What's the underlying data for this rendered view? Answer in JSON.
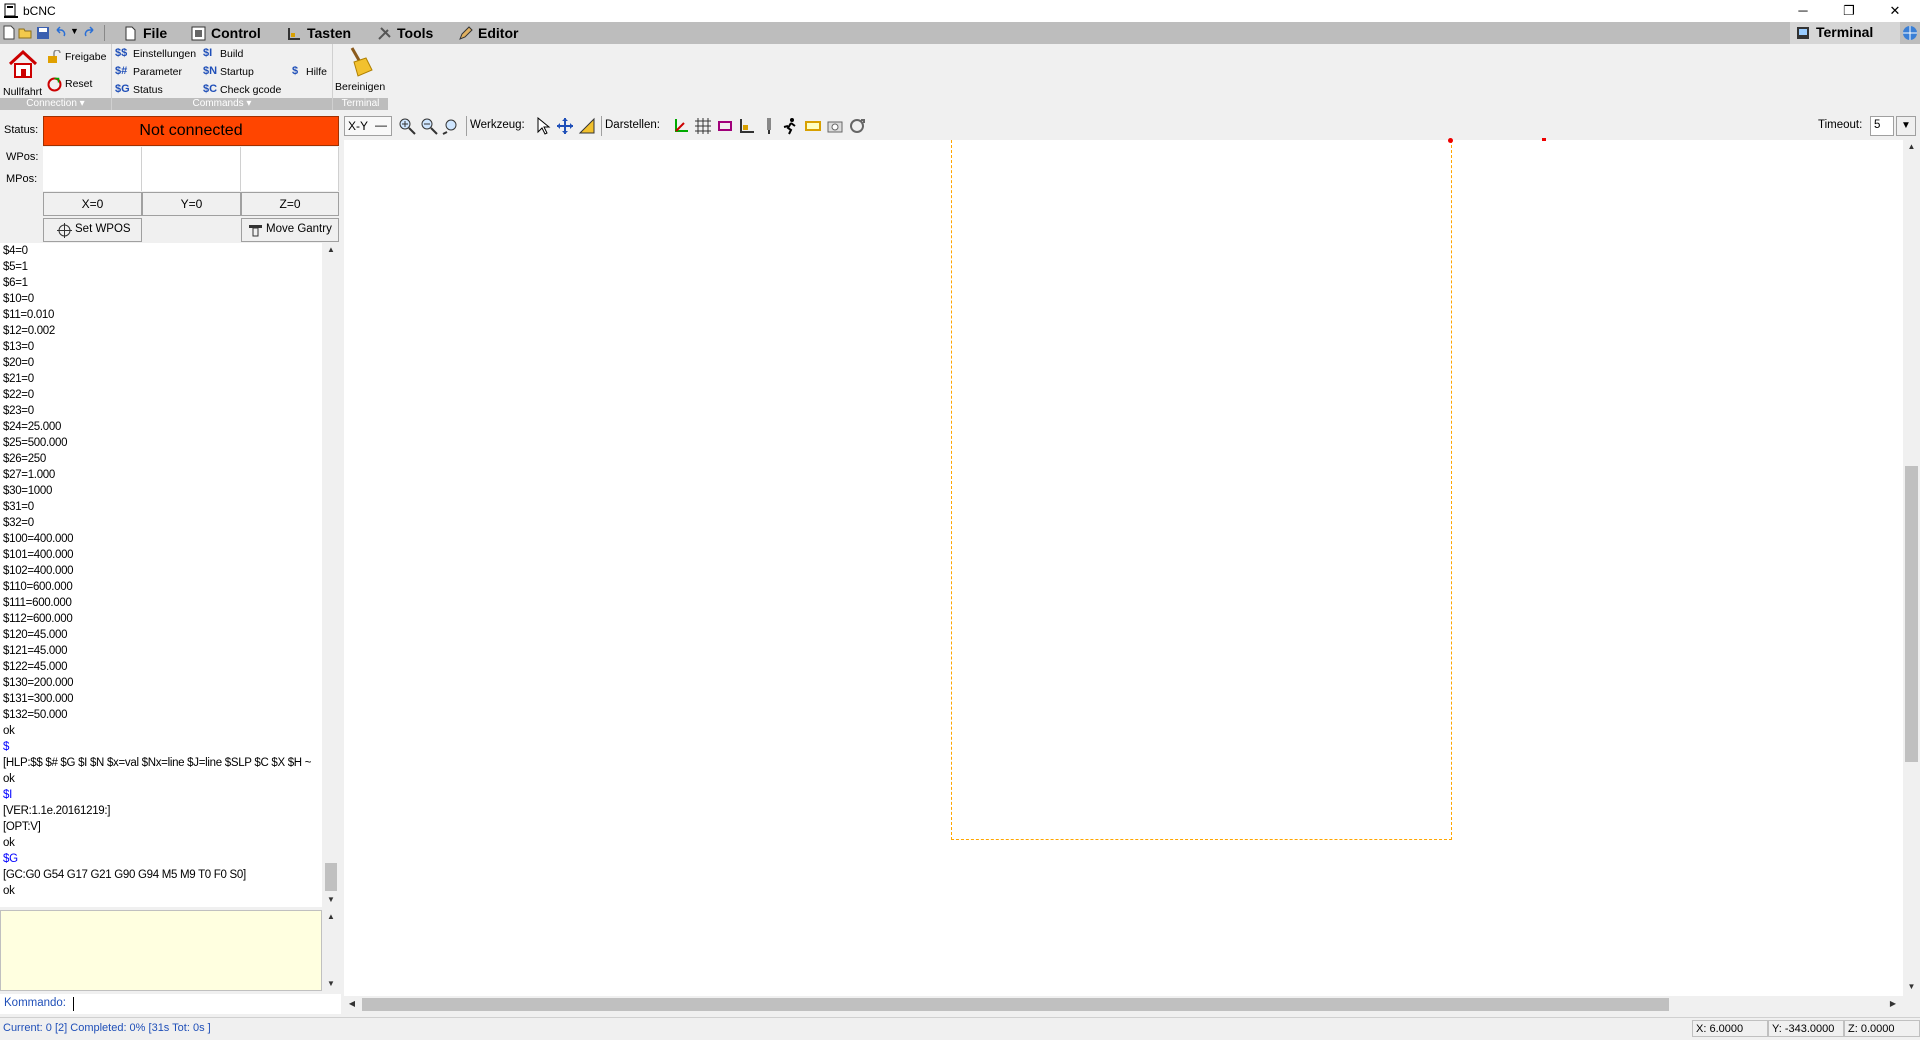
{
  "window": {
    "title": "bCNC",
    "minimize": "─",
    "restore": "❐",
    "close": "✕"
  },
  "menubar": {
    "items": [
      "File",
      "Control",
      "Tasten",
      "Tools",
      "Editor"
    ],
    "terminal_tab": "Terminal"
  },
  "ribbon": {
    "connection": {
      "home_label": "Nullfahrt",
      "unlock_label": "Freigabe",
      "reset_label": "Reset",
      "footer": "Connection"
    },
    "commands": {
      "items": [
        {
          "code": "$$",
          "label": "Einstellungen"
        },
        {
          "code": "$#",
          "label": "Parameter"
        },
        {
          "code": "$G",
          "label": "Status"
        },
        {
          "code": "$I",
          "label": "Build"
        },
        {
          "code": "$N",
          "label": "Startup"
        },
        {
          "code": "$C",
          "label": "Check gcode"
        },
        {
          "code": "$",
          "label": "Hilfe"
        }
      ],
      "footer": "Commands"
    },
    "terminal": {
      "clear_label": "Bereinigen",
      "footer": "Terminal"
    }
  },
  "dro": {
    "status_label": "Status:",
    "status_value": "Not connected",
    "wpos_label": "WPos:",
    "mpos_label": "MPos:",
    "zero_x": "X=0",
    "zero_y": "Y=0",
    "zero_z": "Z=0",
    "set_wpos": "Set WPOS",
    "move_gantry": "Move Gantry"
  },
  "terminal_lines": [
    {
      "text": "$4=0",
      "cmd": false
    },
    {
      "text": "$5=1",
      "cmd": false
    },
    {
      "text": "$6=1",
      "cmd": false
    },
    {
      "text": "$10=0",
      "cmd": false
    },
    {
      "text": "$11=0.010",
      "cmd": false
    },
    {
      "text": "$12=0.002",
      "cmd": false
    },
    {
      "text": "$13=0",
      "cmd": false
    },
    {
      "text": "$20=0",
      "cmd": false
    },
    {
      "text": "$21=0",
      "cmd": false
    },
    {
      "text": "$22=0",
      "cmd": false
    },
    {
      "text": "$23=0",
      "cmd": false
    },
    {
      "text": "$24=25.000",
      "cmd": false
    },
    {
      "text": "$25=500.000",
      "cmd": false
    },
    {
      "text": "$26=250",
      "cmd": false
    },
    {
      "text": "$27=1.000",
      "cmd": false
    },
    {
      "text": "$30=1000",
      "cmd": false
    },
    {
      "text": "$31=0",
      "cmd": false
    },
    {
      "text": "$32=0",
      "cmd": false
    },
    {
      "text": "$100=400.000",
      "cmd": false
    },
    {
      "text": "$101=400.000",
      "cmd": false
    },
    {
      "text": "$102=400.000",
      "cmd": false
    },
    {
      "text": "$110=600.000",
      "cmd": false
    },
    {
      "text": "$111=600.000",
      "cmd": false
    },
    {
      "text": "$112=600.000",
      "cmd": false
    },
    {
      "text": "$120=45.000",
      "cmd": false
    },
    {
      "text": "$121=45.000",
      "cmd": false
    },
    {
      "text": "$122=45.000",
      "cmd": false
    },
    {
      "text": "$130=200.000",
      "cmd": false
    },
    {
      "text": "$131=300.000",
      "cmd": false
    },
    {
      "text": "$132=50.000",
      "cmd": false
    },
    {
      "text": "ok",
      "cmd": false
    },
    {
      "text": "$",
      "cmd": true
    },
    {
      "text": "[HLP:$$ $# $G $I $N $x=val $Nx=line $J=line $SLP $C $X $H ~",
      "cmd": false
    },
    {
      "text": "ok",
      "cmd": false
    },
    {
      "text": "$I",
      "cmd": true
    },
    {
      "text": "[VER:1.1e.20161219:]",
      "cmd": false
    },
    {
      "text": "[OPT:V]",
      "cmd": false
    },
    {
      "text": "ok",
      "cmd": false
    },
    {
      "text": "$G",
      "cmd": true
    },
    {
      "text": "[GC:G0 G54 G17 G21 G90 G94 M5 M9 T0 F0 S0]",
      "cmd": false
    },
    {
      "text": "ok",
      "cmd": false
    }
  ],
  "kommando_label": "Kommando:",
  "canvas_toolbar": {
    "view": "X-Y",
    "werkzeug_label": "Werkzeug:",
    "darstellen_label": "Darstellen:",
    "timeout_label": "Timeout:",
    "timeout_value": "5"
  },
  "statusbar": {
    "progress": "Current: 0 [2]  Completed: 0% [31s Tot: 0s ]",
    "x": "X: 6.0000",
    "y": "Y: -343.0000",
    "z": "Z: 0.0000"
  },
  "colors": {
    "status_bg": "#ff4500",
    "command_text": "#0000ff",
    "margin_rect": "#ffa500",
    "cmd_area_bg": "#ffffe0"
  }
}
